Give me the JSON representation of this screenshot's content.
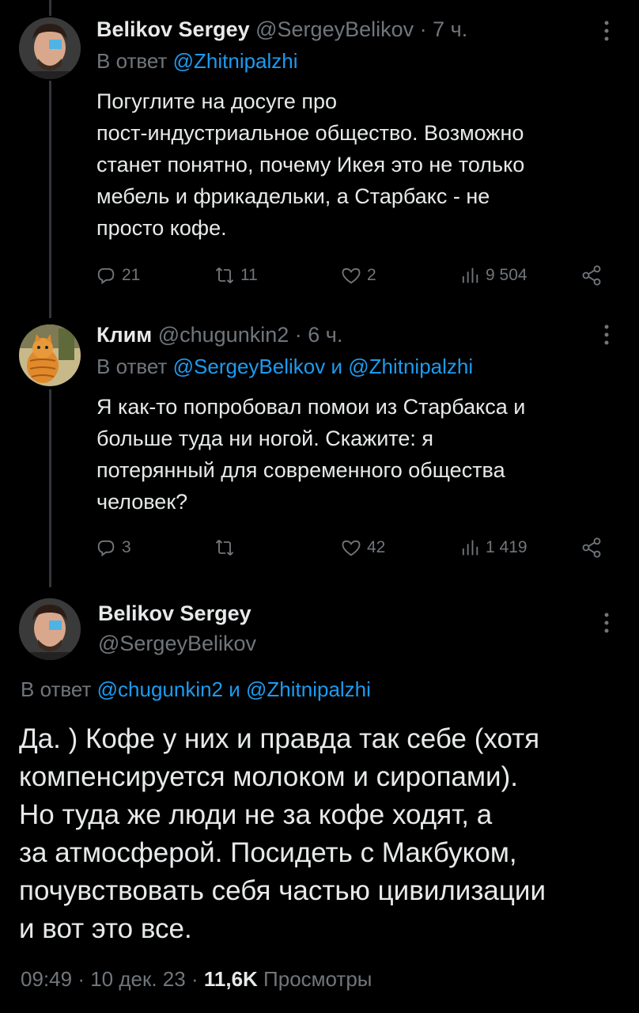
{
  "tweets": [
    {
      "author": "Belikov Sergey",
      "handle": "@SergeyBelikov",
      "time": "· 7 ч.",
      "reply_prefix": "В ответ",
      "reply_to": "@Zhitnipalzhi",
      "text": "Погуглите на досуге про\nпост-индустриальное общество. Возможно\nстанет понятно, почему Икея это не только\nмебель и фрикадельки, а Старбакс - не\nпросто кофе.",
      "stats": {
        "replies": "21",
        "retweets": "11",
        "likes": "2",
        "views": "9 504"
      }
    },
    {
      "author": "Клим",
      "handle": "@chugunkin2",
      "time": "· 6 ч.",
      "reply_prefix": "В ответ",
      "reply_to_1": "@SergeyBelikov",
      "reply_and": "и",
      "reply_to_2": "@Zhitnipalzhi",
      "text": "Я как-то попробовал помои из Старбакса и\nбольше туда ни ногой. Скажите: я\nпотерянный для современного общества\nчеловек?",
      "stats": {
        "replies": "3",
        "retweets": "",
        "likes": "42",
        "views": "1 419"
      }
    }
  ],
  "main": {
    "author": "Belikov Sergey",
    "handle": "@SergeyBelikov",
    "reply_prefix": "В ответ",
    "reply_to_1": "@chugunkin2",
    "reply_and": "и",
    "reply_to_2": "@Zhitnipalzhi",
    "text": "Да. ) Кофе у них и правда так себе (хотя\nкомпенсируется молоком и сиропами).\nНо туда же люди не за кофе ходят, а\nза атмосферой. Посидеть с Макбуком,\nпочувствовать себя частью цивилизации\nи вот это все.",
    "time": "09:49",
    "date": "10 дек. 23",
    "views_count": "11,6K",
    "views_label": "Просмотры"
  },
  "icons": [
    "reply-icon",
    "retweet-icon",
    "like-icon",
    "views-icon",
    "share-icon",
    "more-icon"
  ],
  "colors": {
    "background": "#000000",
    "text": "#e7e9ea",
    "muted": "#71767b",
    "link": "#1d9bf0"
  }
}
